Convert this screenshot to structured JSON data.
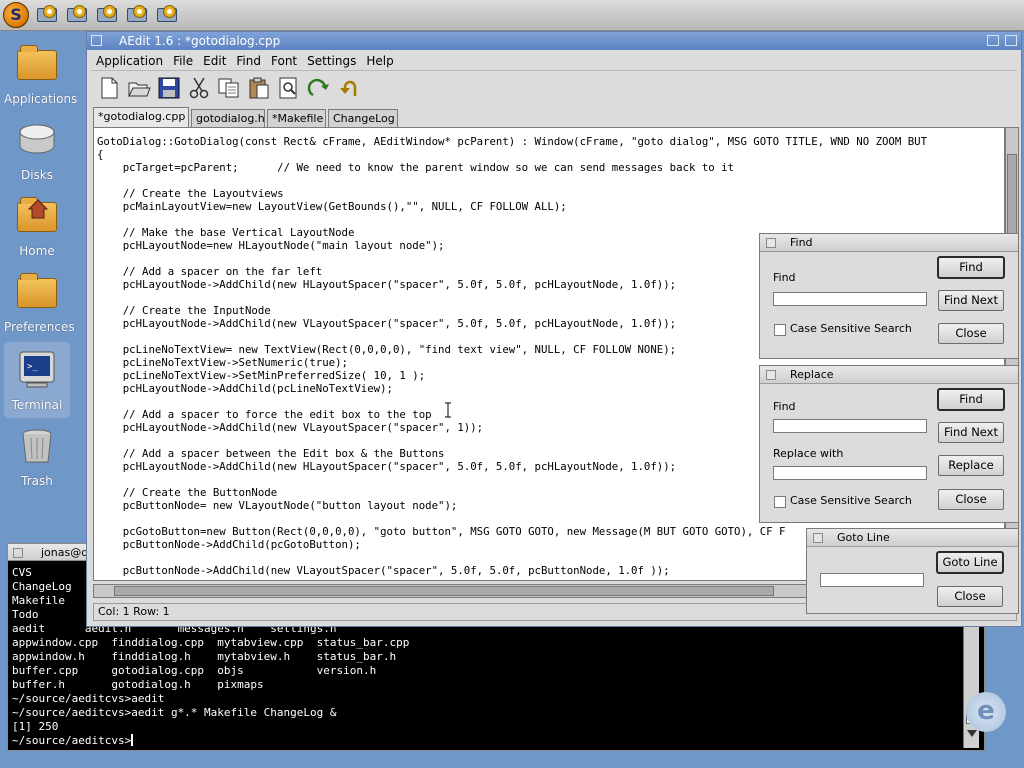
{
  "launcher": {
    "items": [
      "app-launcher-1",
      "app-launcher-2",
      "app-launcher-3",
      "app-launcher-4",
      "app-launcher-5"
    ]
  },
  "desktop": {
    "icons": [
      {
        "label": "Applications",
        "icon": "folder-icon"
      },
      {
        "label": "Disks",
        "icon": "disk-icon"
      },
      {
        "label": "Home",
        "icon": "home-folder-icon"
      },
      {
        "label": "Preferences",
        "icon": "folder-icon"
      },
      {
        "label": "Terminal",
        "icon": "terminal-icon"
      },
      {
        "label": "Trash",
        "icon": "trash-icon"
      }
    ]
  },
  "aedit": {
    "title": "AEdit 1.6 : *gotodialog.cpp",
    "menu": [
      "Application",
      "File",
      "Edit",
      "Find",
      "Font",
      "Settings",
      "Help"
    ],
    "toolbar": [
      "new-icon",
      "open-icon",
      "save-icon",
      "cut-icon",
      "copy-icon",
      "paste-icon",
      "find-icon",
      "redo-icon",
      "undo-icon"
    ],
    "tabs": [
      "*gotodialog.cpp",
      "gotodialog.h",
      "*Makefile",
      "ChangeLog"
    ],
    "code": [
      "",
      "GotoDialog::GotoDialog(const Rect& cFrame, AEditWindow* pcParent) : Window(cFrame, \"goto dialog\", MSG GOTO TITLE, WND NO ZOOM BUT",
      "{",
      "    pcTarget=pcParent;      // We need to know the parent window so we can send messages back to it",
      "",
      "    // Create the Layoutviews",
      "    pcMainLayoutView=new LayoutView(GetBounds(),\"\", NULL, CF FOLLOW ALL);",
      "",
      "    // Make the base Vertical LayoutNode",
      "    pcHLayoutNode=new HLayoutNode(\"main layout node\");",
      "",
      "    // Add a spacer on the far left",
      "    pcHLayoutNode->AddChild(new HLayoutSpacer(\"spacer\", 5.0f, 5.0f, pcHLayoutNode, 1.0f));",
      "",
      "    // Create the InputNode",
      "    pcHLayoutNode->AddChild(new VLayoutSpacer(\"spacer\", 5.0f, 5.0f, pcHLayoutNode, 1.0f));",
      "",
      "    pcLineNoTextView= new TextView(Rect(0,0,0,0), \"find text view\", NULL, CF FOLLOW NONE);",
      "    pcLineNoTextView->SetNumeric(true);",
      "    pcLineNoTextView->SetMinPreferredSize( 10, 1 );",
      "    pcHLayoutNode->AddChild(pcLineNoTextView);",
      "",
      "    // Add a spacer to force the edit box to the top",
      "    pcHLayoutNode->AddChild(new VLayoutSpacer(\"spacer\", 1));",
      "",
      "    // Add a spacer between the Edit box & the Buttons",
      "    pcHLayoutNode->AddChild(new HLayoutSpacer(\"spacer\", 5.0f, 5.0f, pcHLayoutNode, 1.0f));",
      "",
      "    // Create the ButtonNode",
      "    pcButtonNode= new VLayoutNode(\"button layout node\");",
      "",
      "    pcGotoButton=new Button(Rect(0,0,0,0), \"goto button\", MSG GOTO GOTO, new Message(M BUT GOTO GOTO), CF F",
      "    pcButtonNode->AddChild(pcGotoButton);",
      "",
      "    pcButtonNode->AddChild(new VLayoutSpacer(\"spacer\", 5.0f, 5.0f, pcButtonNode, 1.0f ));"
    ],
    "status": "Col: 1 Row: 1"
  },
  "find_dialog": {
    "title": "Find",
    "find_label": "Find",
    "find_value": "",
    "case_label": "Case Sensitive Search",
    "btn_find": "Find",
    "btn_find_next": "Find Next",
    "btn_close": "Close"
  },
  "replace_dialog": {
    "title": "Replace",
    "find_label": "Find",
    "find_value": "",
    "replace_label": "Replace with",
    "replace_value": "",
    "case_label": "Case Sensitive Search",
    "btn_find": "Find",
    "btn_find_next": "Find Next",
    "btn_replace": "Replace",
    "btn_close": "Close"
  },
  "goto_dialog": {
    "title": "Goto Line",
    "line_value": "",
    "btn_goto": "Goto Line",
    "btn_close": "Close"
  },
  "terminal": {
    "title": "jonas@de",
    "lines": [
      "CVS",
      "ChangeLog",
      "Makefile",
      "Todo",
      "aedit      aedit.h       messages.h    settings.h",
      "appwindow.cpp  finddialog.cpp  mytabview.cpp  status_bar.cpp",
      "appwindow.h    finddialog.h    mytabview.h    status_bar.h",
      "buffer.cpp     gotodialog.cpp  objs           version.h",
      "buffer.h       gotodialog.h    pixmaps",
      "~/source/aeditcvs>aedit",
      "~/source/aeditcvs>aedit g*.* Makefile ChangeLog &",
      "[1] 250",
      "~/source/aeditcvs>"
    ]
  }
}
